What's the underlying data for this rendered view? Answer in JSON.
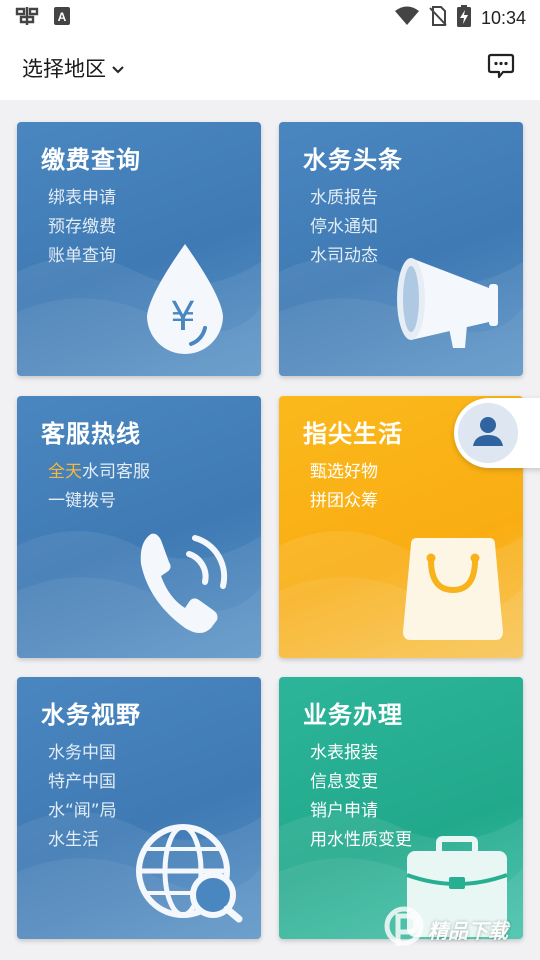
{
  "status": {
    "time": "10:34",
    "icons": [
      "bug-icon",
      "a-badge-icon",
      "wifi-icon",
      "no-sim-icon",
      "battery-charging-icon"
    ]
  },
  "header": {
    "region_label": "选择地区",
    "message_icon": "chat-icon"
  },
  "cards": [
    {
      "title": "缴费查询",
      "items": [
        "绑表申请",
        "预存缴费",
        "账单查询"
      ],
      "icon": "water-drop-yen-icon",
      "theme": "blue"
    },
    {
      "title": "水务头条",
      "items": [
        "水质报告",
        "停水通知",
        "水司动态"
      ],
      "icon": "megaphone-icon",
      "theme": "blue"
    },
    {
      "title": "客服热线",
      "items_rich": [
        {
          "highlight": "全天",
          "rest": "水司客服"
        }
      ],
      "items": [
        "一键拨号"
      ],
      "icon": "phone-icon",
      "theme": "blue"
    },
    {
      "title": "指尖生活",
      "items": [
        "甄选好物",
        "拼团众筹"
      ],
      "icon": "shopping-bag-icon",
      "theme": "yellow"
    },
    {
      "title": "水务视野",
      "items": [
        "水务中国",
        "特产中国",
        "水“闻”局",
        "水生活"
      ],
      "icon": "globe-search-icon",
      "theme": "blue"
    },
    {
      "title": "业务办理",
      "items": [
        "水表报装",
        "信息变更",
        "销户申请",
        "用水性质变更"
      ],
      "icon": "briefcase-icon",
      "theme": "green"
    }
  ],
  "colors": {
    "blue_card": "#4381bb",
    "yellow_card": "#fbb91c",
    "green_card": "#27af92",
    "highlight": "#f6b73c"
  },
  "watermark": {
    "text": "精品下载"
  }
}
